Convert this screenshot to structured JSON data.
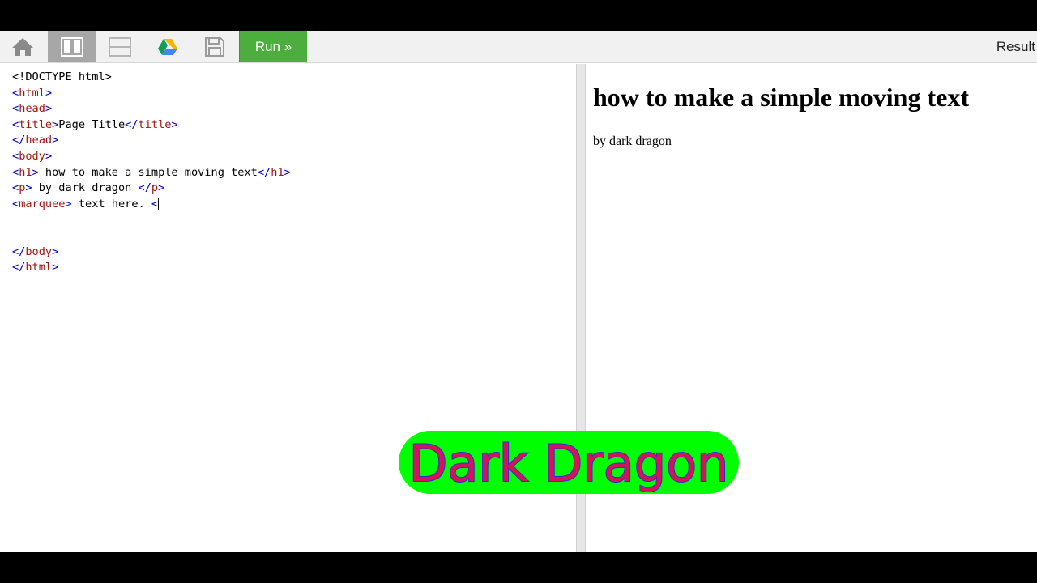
{
  "toolbar": {
    "run_label": "Run »",
    "result_label": "Result",
    "icons": [
      "home-icon",
      "split-vertical-icon",
      "split-horizontal-icon",
      "google-drive-icon",
      "save-icon"
    ]
  },
  "editor": {
    "lines": [
      "<!DOCTYPE html>",
      "<html>",
      "<head>",
      "<title>Page Title</title>",
      "</head>",
      "<body>",
      "<h1> how to make a simple moving text</h1>",
      "<p> by dark dragon </p>",
      "<marquee> text here. <",
      "",
      "",
      "</body>",
      "</html>"
    ]
  },
  "result": {
    "heading": "how to make a simple moving text",
    "paragraph": "by dark dragon"
  },
  "watermark": {
    "text": "Dark Dragon",
    "bg_color": "#00ff00",
    "text_color": "#d4145a",
    "outline_color": "#2b2bd6"
  },
  "colors": {
    "run_button": "#4caf3d",
    "tag_color": "#a31515",
    "bracket_color": "#0000cc"
  }
}
